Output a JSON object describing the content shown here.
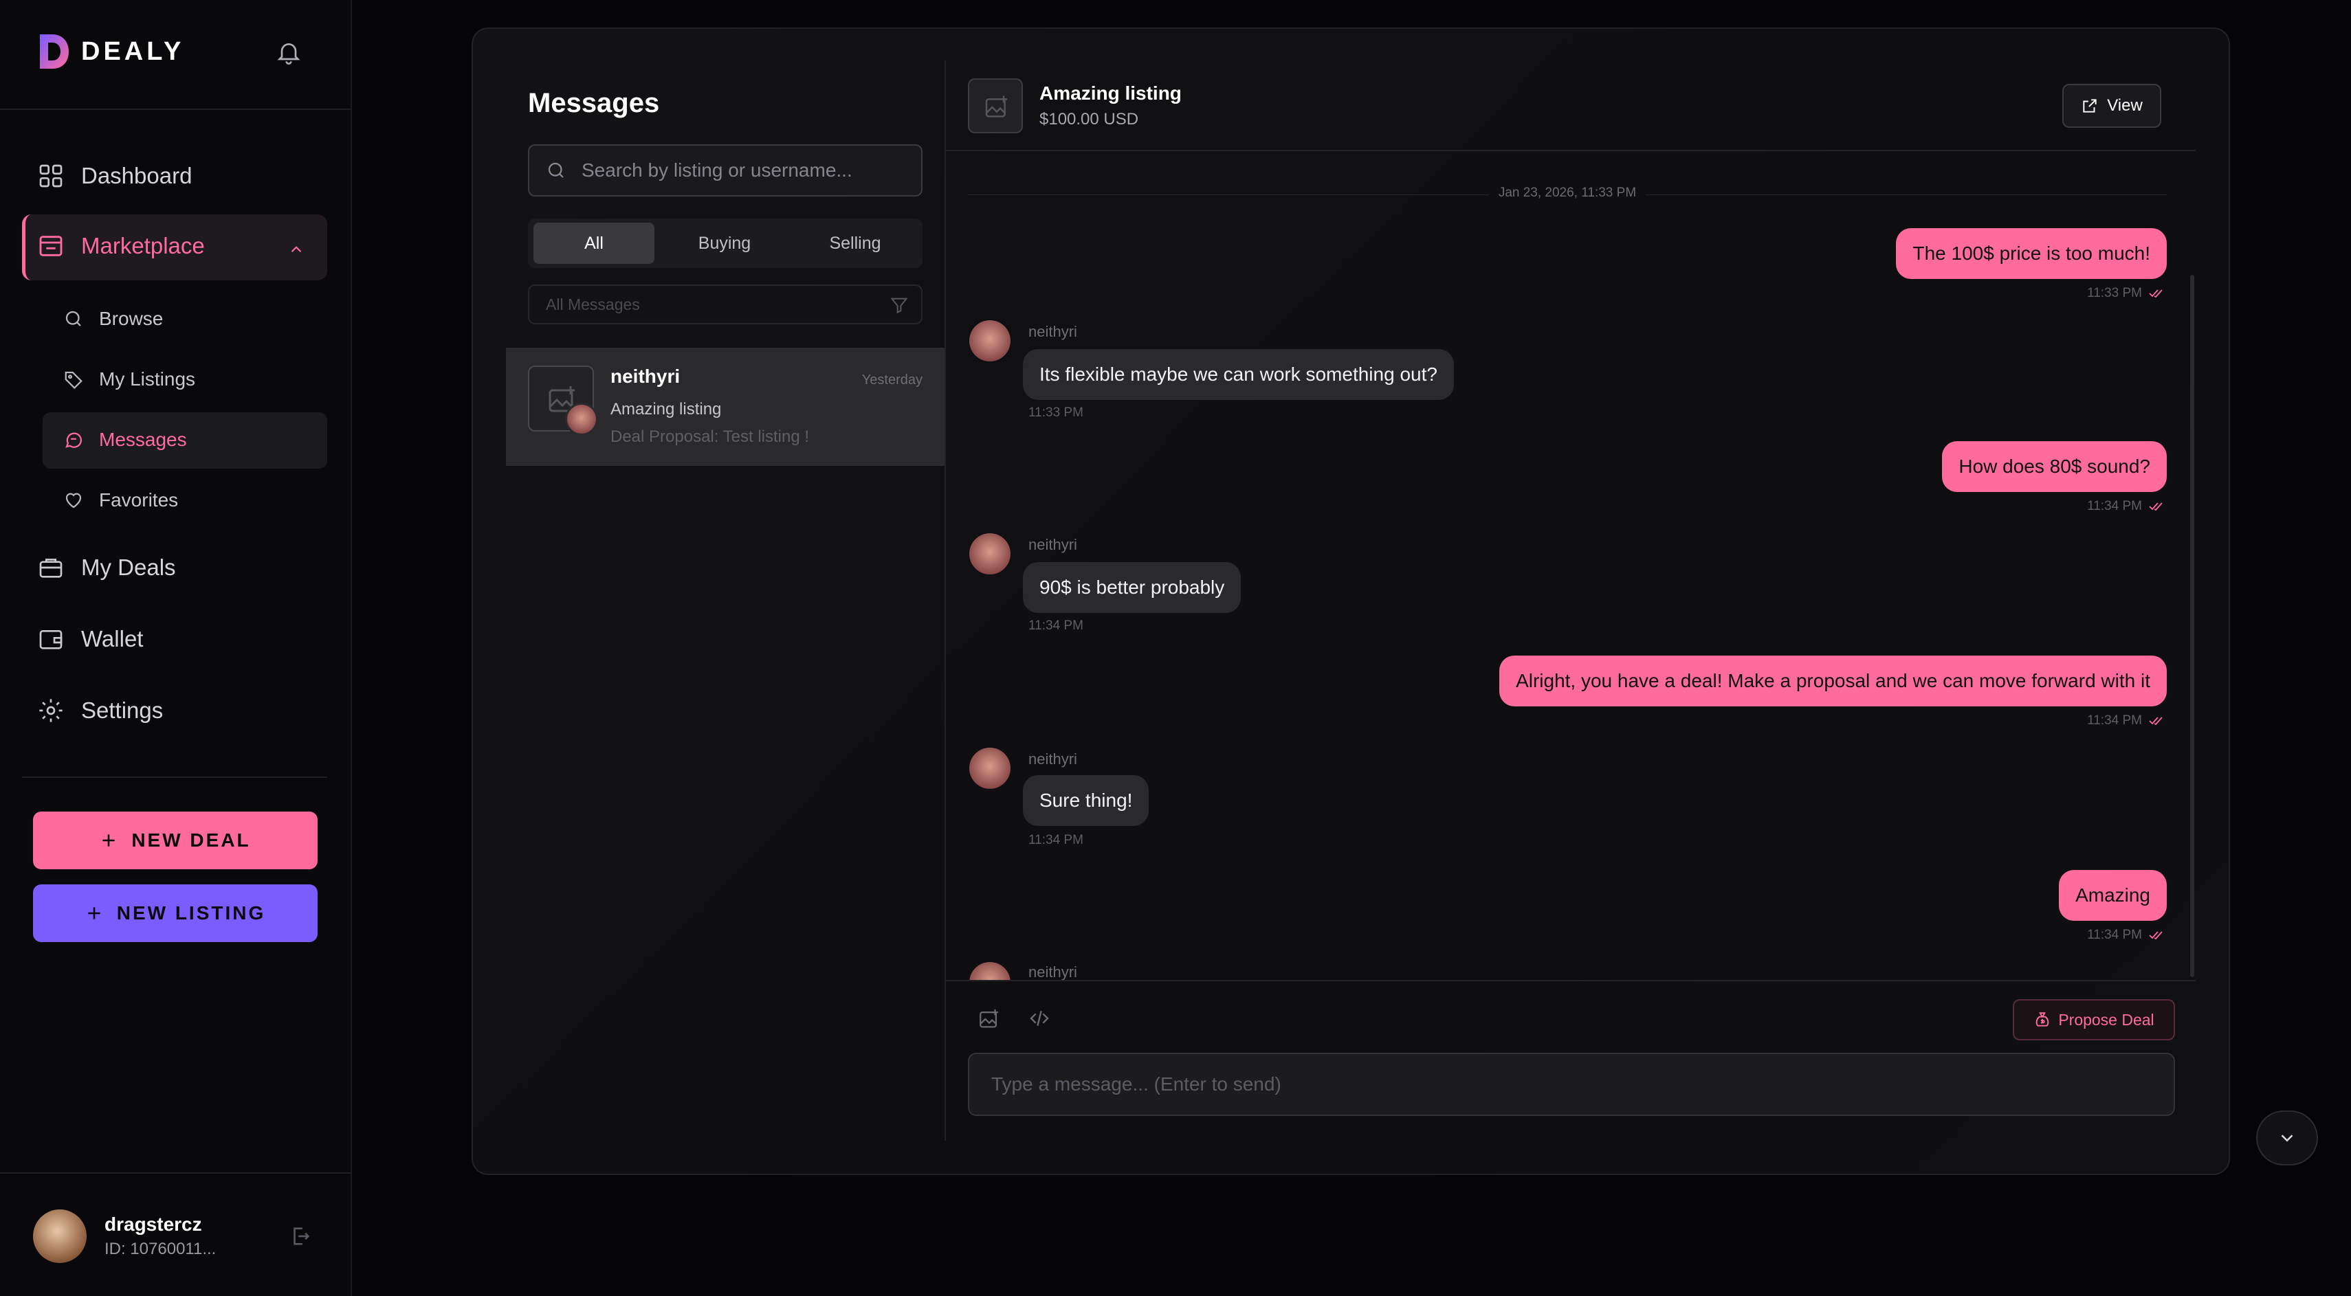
{
  "app": {
    "name": "DEALY"
  },
  "nav": {
    "dashboard": "Dashboard",
    "marketplace": "Marketplace",
    "browse": "Browse",
    "my_listings": "My Listings",
    "messages": "Messages",
    "favorites": "Favorites",
    "my_deals": "My Deals",
    "wallet": "Wallet",
    "settings": "Settings"
  },
  "actions": {
    "new_deal": "NEW DEAL",
    "new_listing": "NEW LISTING"
  },
  "user": {
    "name": "dragstercz",
    "id": "ID: 10760011..."
  },
  "messages_panel": {
    "title": "Messages",
    "search_placeholder": "Search by listing or username...",
    "tabs": [
      "All",
      "Buying",
      "Selling"
    ],
    "active_tab": "All",
    "filter_label": "All Messages",
    "conversations": [
      {
        "name": "neithyri",
        "date": "Yesterday",
        "listing": "Amazing listing",
        "preview": "Deal Proposal: Test listing !"
      }
    ]
  },
  "chat": {
    "listing_title": "Amazing listing",
    "listing_price": "$100.00 USD",
    "view_label": "View",
    "date_separator": "Jan 23, 2026, 11:33 PM",
    "messages": [
      {
        "dir": "out",
        "text": "The 100$ price is too much!",
        "time": "11:33 PM"
      },
      {
        "dir": "in",
        "sender": "neithyri",
        "text": "Its flexible maybe we can work something out?",
        "time": "11:33 PM"
      },
      {
        "dir": "out",
        "text": "How does 80$ sound?",
        "time": "11:34 PM"
      },
      {
        "dir": "in",
        "sender": "neithyri",
        "text": "90$ is better probably",
        "time": "11:34 PM"
      },
      {
        "dir": "out",
        "text": "Alright, you have a deal! Make a proposal and we can move forward with it",
        "time": "11:34 PM"
      },
      {
        "dir": "in",
        "sender": "neithyri",
        "text": "Sure thing!",
        "time": "11:34 PM"
      },
      {
        "dir": "out",
        "text": "Amazing",
        "time": "11:34 PM"
      },
      {
        "dir": "in",
        "sender": "neithyri"
      }
    ],
    "propose_label": "Propose Deal",
    "input_placeholder": "Type a message... (Enter to send)"
  },
  "colors": {
    "accent_pink": "#ff6b9d",
    "accent_purple": "#7b5cff"
  }
}
